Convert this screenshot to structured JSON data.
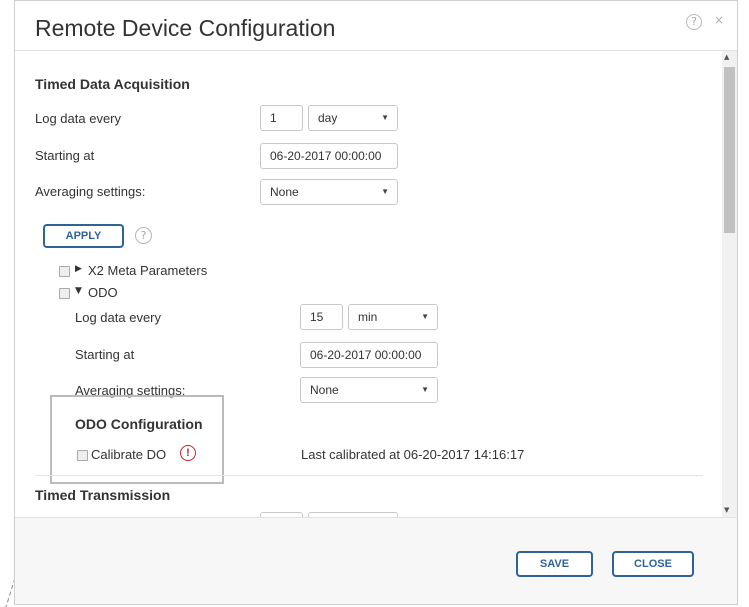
{
  "dialog": {
    "title": "Remote Device Configuration",
    "help_icon": "?",
    "close_icon": "×"
  },
  "timed_data": {
    "heading": "Timed Data Acquisition",
    "log_label": "Log data every",
    "log_value": "1",
    "log_unit": "day",
    "start_label": "Starting at",
    "start_value": "06-20-2017 00:00:00",
    "avg_label": "Averaging settings:",
    "avg_value": "None"
  },
  "apply": {
    "label": "APPLY",
    "help_icon": "?"
  },
  "tree": {
    "x2_label": "X2 Meta Parameters",
    "x2_arrow": "▶",
    "odo_label": "ODO",
    "odo_arrow": "▼"
  },
  "odo": {
    "log_label": "Log data every",
    "log_value": "15",
    "log_unit": "min",
    "start_label": "Starting at",
    "start_value": "06-20-2017 00:00:00",
    "avg_label": "Averaging settings:",
    "avg_value": "None",
    "config_heading": "ODO Configuration",
    "calibrate_label": "Calibrate DO",
    "warning_icon": "!",
    "last_calibrated": "Last calibrated at 06-20-2017 14:16:17"
  },
  "timed_transmission": {
    "heading": "Timed Transmission"
  },
  "footer": {
    "save_label": "SAVE",
    "close_label": "CLOSE"
  },
  "icons": {
    "caret": "▼",
    "scroll_up": "▲",
    "scroll_down": "▼"
  },
  "colors": {
    "accent": "#2d6399",
    "warning": "#cc2222"
  }
}
